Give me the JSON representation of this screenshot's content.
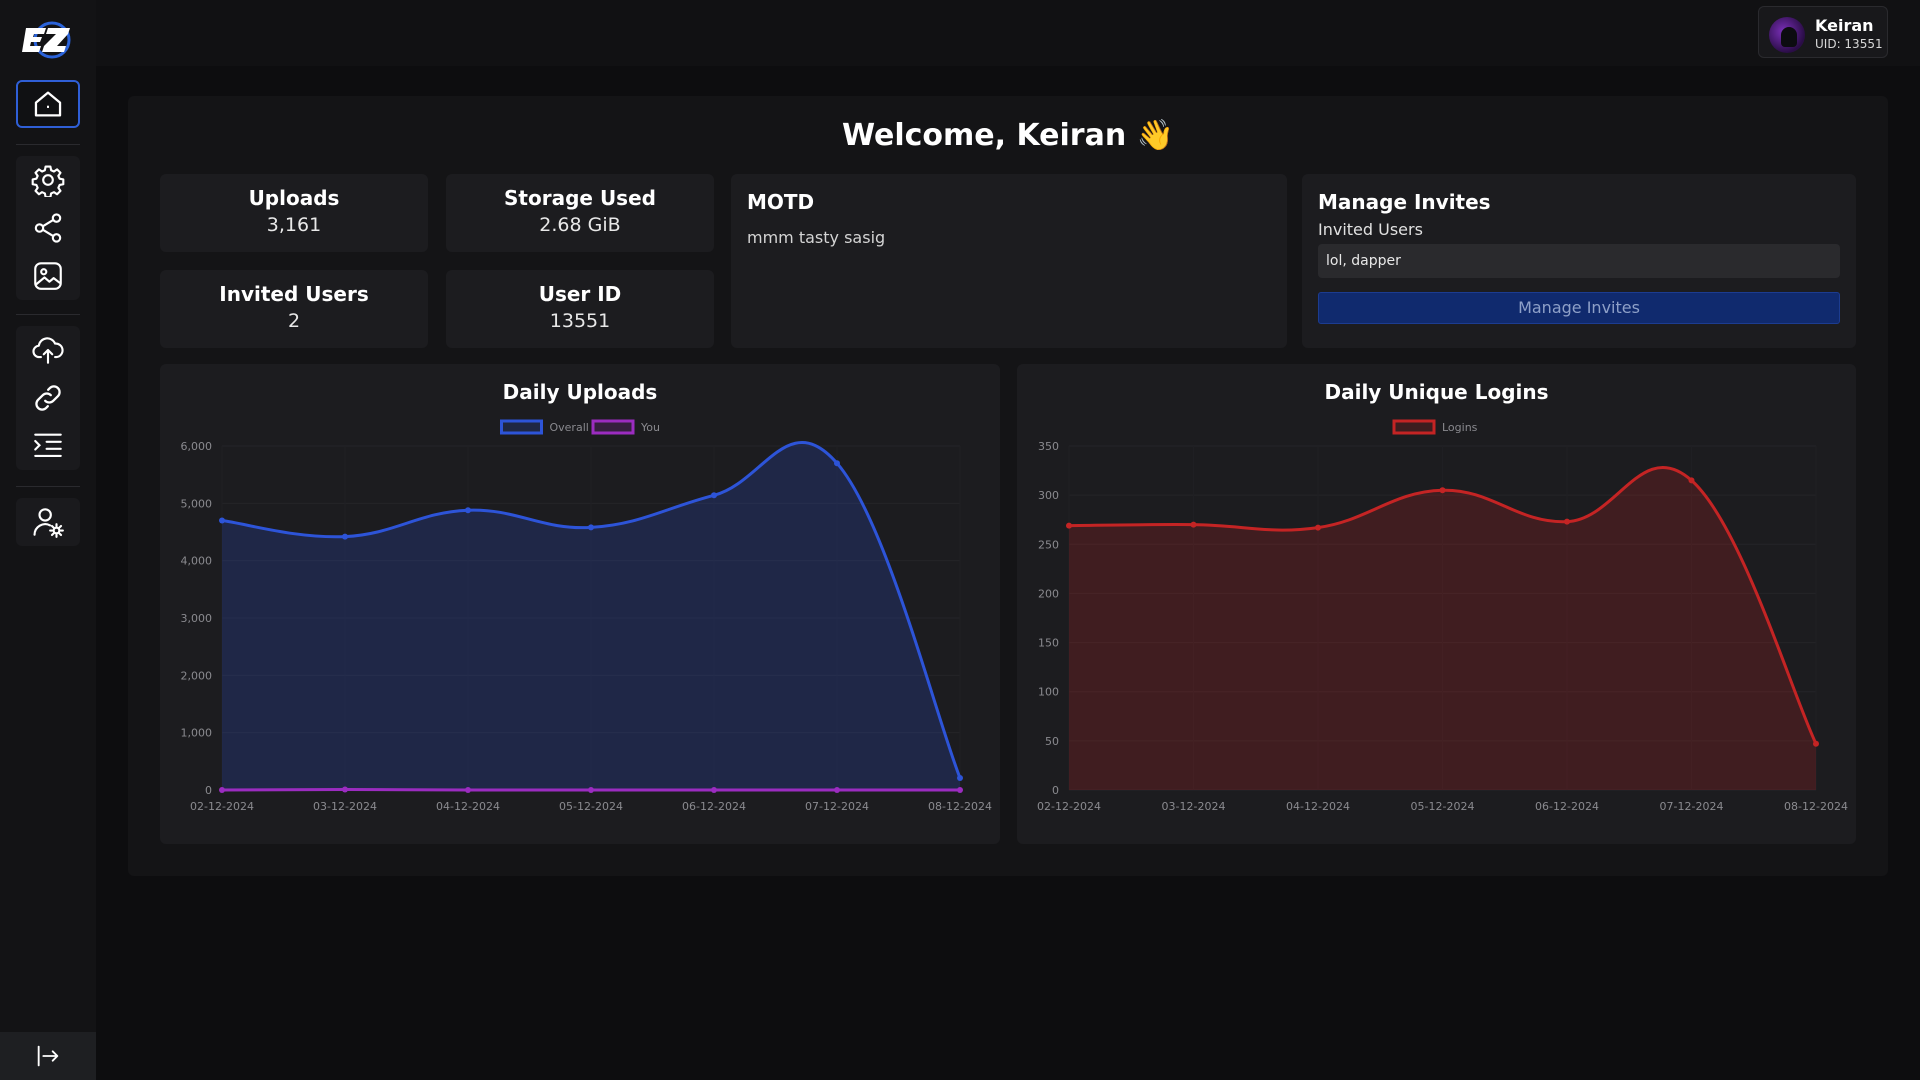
{
  "app": {
    "logo_text": "EZ"
  },
  "sidebar": {
    "items": [
      {
        "name": "home",
        "icon": "home-icon"
      },
      {
        "name": "settings",
        "icon": "gear-icon"
      },
      {
        "name": "share",
        "icon": "share-icon"
      },
      {
        "name": "gallery",
        "icon": "image-icon"
      },
      {
        "name": "upload",
        "icon": "cloud-upload-icon"
      },
      {
        "name": "links",
        "icon": "link-icon"
      },
      {
        "name": "list",
        "icon": "list-icon"
      },
      {
        "name": "user-settings",
        "icon": "user-gear-icon"
      }
    ],
    "logout_icon": "logout-icon"
  },
  "profile": {
    "name": "Keiran",
    "uid": "UID: 13551"
  },
  "welcome": "Welcome, Keiran 👋",
  "stats": {
    "uploads": {
      "label": "Uploads",
      "value": "3,161"
    },
    "storage": {
      "label": "Storage Used",
      "value": "2.68 GiB"
    },
    "invited": {
      "label": "Invited Users",
      "value": "2"
    },
    "userid": {
      "label": "User ID",
      "value": "13551"
    }
  },
  "motd": {
    "title": "MOTD",
    "text": "mmm tasty sasig"
  },
  "invites": {
    "title": "Manage Invites",
    "subtitle": "Invited Users",
    "users": "lol, dapper",
    "button": "Manage Invites"
  },
  "colors": {
    "overall": "#2d54d8",
    "you": "#9b2cc0",
    "logins": "#c42424"
  },
  "chart_data": [
    {
      "type": "area",
      "title": "Daily Uploads",
      "x": [
        "02-12-2024",
        "03-12-2024",
        "04-12-2024",
        "05-12-2024",
        "06-12-2024",
        "07-12-2024",
        "08-12-2024"
      ],
      "series": [
        {
          "name": "Overall",
          "values": [
            4700,
            4420,
            4880,
            4580,
            5140,
            5700,
            210
          ]
        },
        {
          "name": "You",
          "values": [
            0,
            8,
            0,
            0,
            0,
            0,
            0
          ]
        }
      ],
      "yticks": [
        "0",
        "1,000",
        "2,000",
        "3,000",
        "4,000",
        "5,000",
        "6,000"
      ],
      "ylim": [
        0,
        6000
      ],
      "legend": "top"
    },
    {
      "type": "area",
      "title": "Daily Unique Logins",
      "x": [
        "02-12-2024",
        "03-12-2024",
        "04-12-2024",
        "05-12-2024",
        "06-12-2024",
        "07-12-2024",
        "08-12-2024"
      ],
      "series": [
        {
          "name": "Logins",
          "values": [
            269,
            270,
            267,
            305,
            273,
            315,
            47
          ]
        }
      ],
      "yticks": [
        "0",
        "50",
        "100",
        "150",
        "200",
        "250",
        "300",
        "350"
      ],
      "ylim": [
        0,
        350
      ],
      "legend": "top"
    }
  ]
}
